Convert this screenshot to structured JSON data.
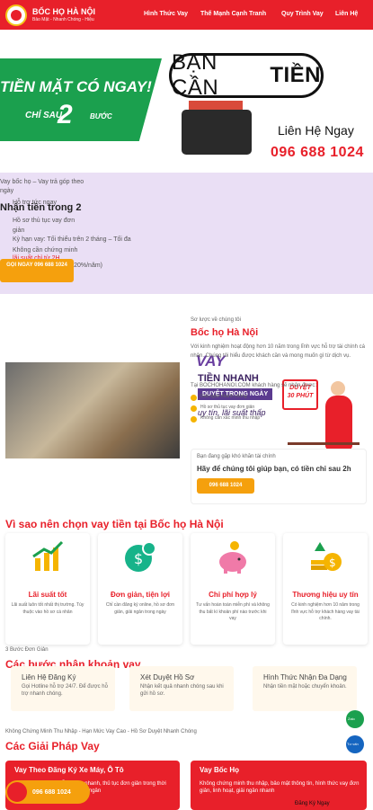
{
  "header": {
    "brand": "BỐC HỌ HÀ NỘI",
    "tagline": "Bảo Mật - Nhanh Chóng - Hiệu",
    "nav": [
      "Hình Thức Vay",
      "Thế Mạnh Cạnh Tranh",
      "Quy Trình Vay",
      "Liên Hệ"
    ]
  },
  "hero": {
    "left_big": "TIỀN MẶT CÓ NGAY!",
    "left_small": "CHỈ SAU",
    "left_num": "2",
    "left_unit": "BƯỚC",
    "bubble_a": "BẠN CẦN",
    "bubble_b": "TIỀN",
    "contact": "Liên Hệ Ngay",
    "phone": "096 688 1024"
  },
  "promo": {
    "small1": "Vay bốc họ – Vay trả góp theo",
    "small2": "ngày",
    "line1": "Hỗ trợ tức ngay",
    "title": "Nhận tiền trong 2",
    "line2": "Hồ sơ thủ tục vay đơn",
    "line3": "giản",
    "line4": "Kỳ hạn vay: Tối thiểu trên 2 tháng – Tối đa",
    "line5": "Không cần chứng minh",
    "line6": "lãi suất chỉ từ 2H",
    "line7": "Lãi suất: 1.5%/tháng (20%/năm)",
    "button": "GỌI NGAY 096 688 1024",
    "vay": "VAY",
    "tien_nhanh": "TIỀN NHANH",
    "duyet_ngay": "DUYỆT TRONG NGÀY",
    "uy_tin": "uy tín, lãi suất thấp",
    "cal_a": "DUYỆT",
    "cal_b": "30 PHÚT"
  },
  "about": {
    "kicker": "Sơ lược về chúng tôi",
    "title": "Bốc họ Hà Nội",
    "desc": "Với kinh nghiệm hoạt động hơn 10 năm trong lĩnh vực hỗ trợ tài chính cá nhân. Chúng tôi hiểu được khách cần và mong muốn gì từ dịch vụ.",
    "lead": "Tại BOCHOHANOI.COM khách hàng sẽ nhận được:",
    "bullets": [
      "Giải ngân nhanh chóng",
      "Hồ sơ thủ tục vay đơn giản",
      "Không cần xác minh thu nhập"
    ],
    "help_small": "Bạn đang gặp khó khăn tài chính",
    "help_big": "Hãy để chúng tôi giúp bạn, có tiền chỉ sau 2h",
    "help_btn": "096 688 1024"
  },
  "why": {
    "title": "Vì sao nên chọn vay tiền tại Bốc họ Hà Nội",
    "cards": [
      {
        "title": "Lãi suất tốt",
        "desc": "Lãi suất luôn tốt nhất thị trường. Tùy thuộc vào hồ sơ cá nhân"
      },
      {
        "title": "Đơn giản, tiện lợi",
        "desc": "Chỉ cần đăng ký online, hồ sơ đơn giản, giải ngân trong ngày"
      },
      {
        "title": "Chi phí hợp lý",
        "desc": "Tư vấn hoàn toàn miễn phí và không thu bất kì khoản phí nào trước khi vay"
      },
      {
        "title": "Thương hiệu uy tín",
        "desc": "Có kinh nghiệm hơn 10 năm trong lĩnh vực hỗ trợ khách hàng vay tài chính."
      }
    ]
  },
  "steps": {
    "kicker": "3 Bước Đơn Giản",
    "title": "Các bước nhận khoản vay",
    "items": [
      {
        "title": "Liên Hệ Đăng Ký",
        "desc": "Gọi Hotline hỗ trợ 24/7. Để được hỗ trợ nhanh chóng."
      },
      {
        "title": "Xét Duyệt Hồ Sơ",
        "desc": "Nhận kết quả nhanh chóng sau khi gửi hồ sơ."
      },
      {
        "title": "Hình Thức Nhận Đa Dạng",
        "desc": "Nhận tiền mặt hoặc chuyển khoản."
      }
    ]
  },
  "solutions": {
    "kicker": "Không Chứng Minh Thu Nhập - Hạn Mức Vay Cao - Hồ Sơ Duyệt Nhanh Chóng",
    "title": "Các Giải Pháp Vay",
    "items": [
      {
        "title": "Vay Theo Đăng Ký Xe Máy, Ô Tô",
        "desc": "Khách hàng được hỗ trợ vay nhanh, thủ tục đơn giản trong thời gian vay, thủ tục đơn giản, giải ngân"
      },
      {
        "title": "Vay Bốc Họ",
        "desc": "Không chứng minh thu nhập, bảo mật thông tin, hình thức vay đơn giản, linh hoạt, giải ngân nhanh"
      }
    ],
    "register": "Đăng Ký Ngay"
  },
  "float": {
    "call": "096 688 1024",
    "zalo": "Zalo",
    "mess": "Tư vấn"
  },
  "colors": {
    "primary": "#e8202a",
    "accent": "#f5a00d",
    "green": "#1ba04e",
    "purple": "#eadff5"
  }
}
